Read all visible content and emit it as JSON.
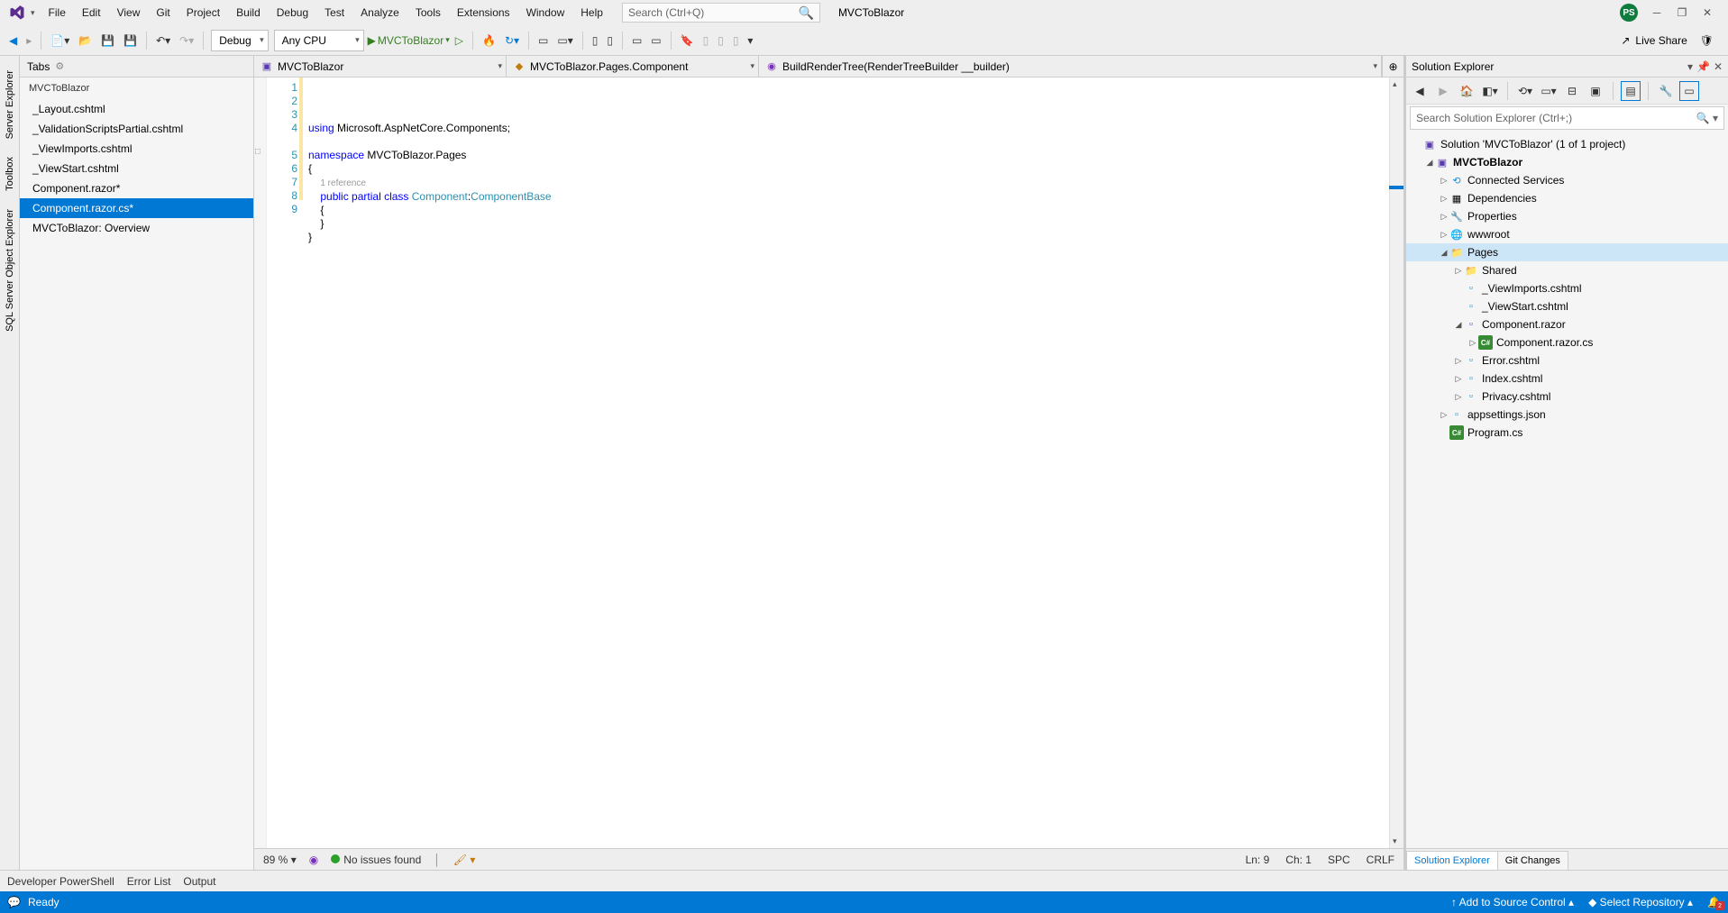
{
  "menubar": {
    "items": [
      "File",
      "Edit",
      "View",
      "Git",
      "Project",
      "Build",
      "Debug",
      "Test",
      "Analyze",
      "Tools",
      "Extensions",
      "Window",
      "Help"
    ],
    "search_placeholder": "Search (Ctrl+Q)",
    "title": "MVCToBlazor",
    "avatar": "PS"
  },
  "toolbar": {
    "config": "Debug",
    "platform": "Any CPU",
    "start_target": "MVCToBlazor",
    "live_share": "Live Share"
  },
  "left_tabs": [
    "Server Explorer",
    "Toolbox",
    "SQL Server Object Explorer"
  ],
  "tabs_panel": {
    "title": "Tabs",
    "group": "MVCToBlazor",
    "items": [
      {
        "label": "_Layout.cshtml",
        "active": false
      },
      {
        "label": "_ValidationScriptsPartial.cshtml",
        "active": false
      },
      {
        "label": "_ViewImports.cshtml",
        "active": false
      },
      {
        "label": "_ViewStart.cshtml",
        "active": false
      },
      {
        "label": "Component.razor*",
        "active": false
      },
      {
        "label": "Component.razor.cs*",
        "active": true
      },
      {
        "label": "MVCToBlazor: Overview",
        "active": false
      }
    ]
  },
  "editor_nav": {
    "scope1": "MVCToBlazor",
    "scope2": "MVCToBlazor.Pages.Component",
    "scope3": "BuildRenderTree(RenderTreeBuilder __builder)"
  },
  "code": {
    "line_count": 9,
    "lines": [
      {
        "n": 1,
        "html": "<span class='kw'>using</span> Microsoft.AspNetCore.Components;"
      },
      {
        "n": 2,
        "html": ""
      },
      {
        "n": 3,
        "html": "<span class='kw'>namespace</span> MVCToBlazor.Pages"
      },
      {
        "n": 4,
        "html": "{"
      },
      {
        "n": 0,
        "html": "    <span class='codelens'>1 reference</span>"
      },
      {
        "n": 5,
        "html": "    <span class='kw'>public</span> <span class='kw'>partial</span> <span class='kw'>class</span> <span class='type'>Component</span>:<span class='type'>ComponentBase</span>"
      },
      {
        "n": 6,
        "html": "    {"
      },
      {
        "n": 7,
        "html": "    }"
      },
      {
        "n": 8,
        "html": "}"
      },
      {
        "n": 9,
        "html": ""
      }
    ]
  },
  "editor_status": {
    "zoom": "89 %",
    "issues": "No issues found",
    "ln": "Ln: 9",
    "ch": "Ch: 1",
    "spc": "SPC",
    "eol": "CRLF"
  },
  "solution": {
    "title": "Solution Explorer",
    "search_placeholder": "Search Solution Explorer (Ctrl+;)",
    "root": "Solution 'MVCToBlazor' (1 of 1 project)",
    "project": "MVCToBlazor",
    "children": {
      "connected": "Connected Services",
      "deps": "Dependencies",
      "props": "Properties",
      "wwwroot": "wwwroot",
      "pages": "Pages",
      "shared": "Shared",
      "viewimports": "_ViewImports.cshtml",
      "viewstart": "_ViewStart.cshtml",
      "component": "Component.razor",
      "component_cs": "Component.razor.cs",
      "error": "Error.cshtml",
      "index": "Index.cshtml",
      "privacy": "Privacy.cshtml",
      "appsettings": "appsettings.json",
      "program": "Program.cs"
    },
    "tabs": {
      "explorer": "Solution Explorer",
      "git": "Git Changes"
    }
  },
  "bottom_tabs": [
    "Developer PowerShell",
    "Error List",
    "Output"
  ],
  "statusbar": {
    "ready": "Ready",
    "source_control": "Add to Source Control",
    "repo": "Select Repository",
    "notifications": "2"
  }
}
